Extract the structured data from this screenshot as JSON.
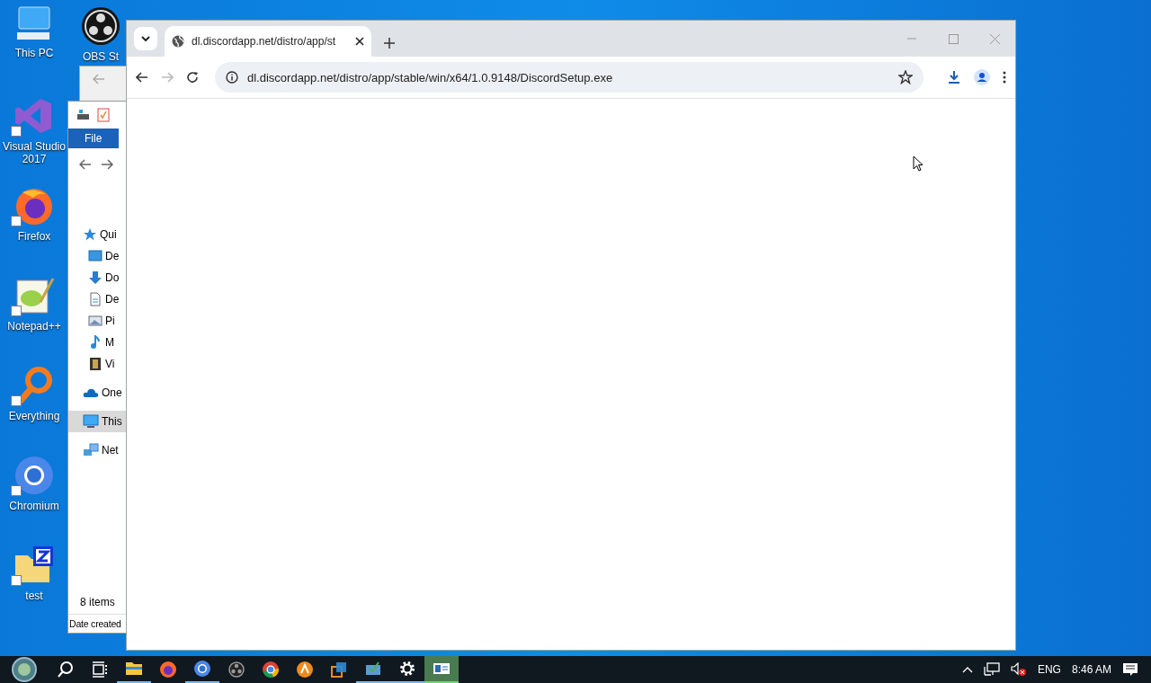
{
  "desktop_icons": [
    {
      "kind": "computer",
      "label": "This PC"
    },
    {
      "kind": "vs",
      "label": "Visual Studio 2017"
    },
    {
      "kind": "firefox",
      "label": "Firefox"
    },
    {
      "kind": "notepad",
      "label": "Notepad++"
    },
    {
      "kind": "everything",
      "label": "Everything"
    },
    {
      "kind": "chromium",
      "label": "Chromium"
    },
    {
      "kind": "zipfolder",
      "label": "test"
    }
  ],
  "desktop_icon_second_column": {
    "kind": "obs",
    "label": "OBS St"
  },
  "explorer": {
    "ribbon_tab": "File",
    "nav_items": [
      {
        "kind": "star",
        "label": "Qui",
        "selected": false
      },
      {
        "kind": "desktop",
        "label": "De",
        "selected": false
      },
      {
        "kind": "download",
        "label": "Do",
        "selected": false
      },
      {
        "kind": "document",
        "label": "De",
        "selected": false
      },
      {
        "kind": "picture",
        "label": "Pi",
        "selected": false
      },
      {
        "kind": "music",
        "label": "M",
        "selected": false
      },
      {
        "kind": "video",
        "label": "Vi",
        "selected": false
      },
      {
        "kind": "cloud",
        "label": "One",
        "selected": false
      },
      {
        "kind": "computer",
        "label": "This",
        "selected": true
      },
      {
        "kind": "network",
        "label": "Net",
        "selected": false
      }
    ],
    "status": "8 items",
    "column_header": "Date created"
  },
  "browser": {
    "tab_title": "dl.discordapp.net/distro/app/st",
    "url": "dl.discordapp.net/distro/app/stable/win/x64/1.0.9148/DiscordSetup.exe",
    "forward_disabled": true
  },
  "taskbar": {
    "apps": [
      {
        "kind": "start",
        "running": false,
        "selected": false
      },
      {
        "kind": "search",
        "running": false,
        "selected": false
      },
      {
        "kind": "taskview",
        "running": false,
        "selected": false
      },
      {
        "kind": "folder",
        "running": true,
        "selected": false
      },
      {
        "kind": "firefox",
        "running": false,
        "selected": false
      },
      {
        "kind": "chromium",
        "running": true,
        "selected": false
      },
      {
        "kind": "obs",
        "running": false,
        "selected": false
      },
      {
        "kind": "chrome",
        "running": false,
        "selected": false
      },
      {
        "kind": "orange",
        "running": false,
        "selected": false
      },
      {
        "kind": "squares",
        "running": false,
        "selected": false
      },
      {
        "kind": "greenapp",
        "running": true,
        "selected": false
      },
      {
        "kind": "gear",
        "running": true,
        "selected": false
      },
      {
        "kind": "panel",
        "running": true,
        "selected": true
      }
    ],
    "language": "ENG",
    "time": "8:46 AM"
  }
}
